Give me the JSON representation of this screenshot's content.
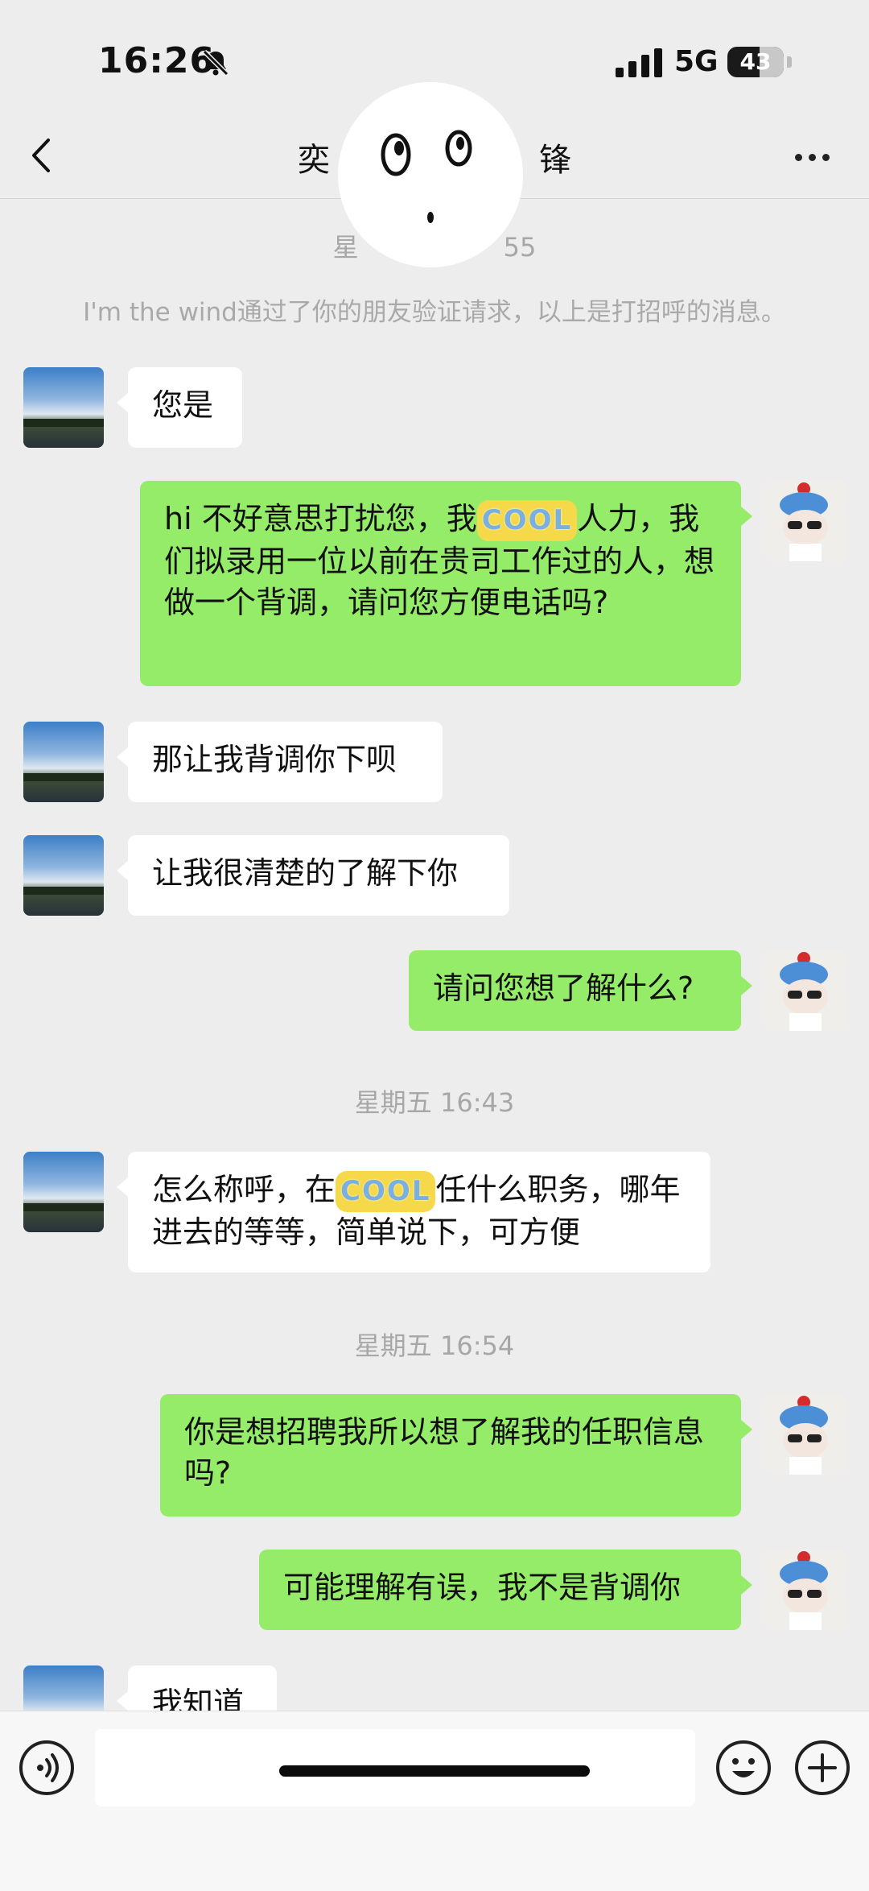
{
  "status_bar": {
    "time": "16:26",
    "network": "5G",
    "battery": "43"
  },
  "nav": {
    "title_left": "奕",
    "title_right": "锋"
  },
  "chat": {
    "header_timestamp": "星",
    "header_timestamp_tail": "55",
    "system_message": "I'm the wind通过了你的朋友验证请求，以上是打招呼的消息。",
    "messages": [
      {
        "side": "in",
        "text": "您是"
      },
      {
        "side": "out",
        "text_a": "hi 不好意思打扰您，我",
        "cool": "COOL",
        "text_b": "人力，我们拟录用一位以前在贵司工作过的人，想做一个背调，请问您方便电话吗?"
      },
      {
        "side": "in",
        "text": "那让我背调你下呗"
      },
      {
        "side": "in",
        "text": "让我很清楚的了解下你"
      },
      {
        "side": "out",
        "text": "请问您想了解什么?"
      },
      {
        "side": "in",
        "text_a": "怎么称呼，在",
        "cool": "COOL",
        "text_b": "任什么职务，哪年进去的等等，简单说下，可方便"
      },
      {
        "side": "out",
        "text": "你是想招聘我所以想了解我的任职信息吗?"
      },
      {
        "side": "out",
        "text": "可能理解有误，我不是背调你"
      },
      {
        "side": "in",
        "text": "我知道"
      }
    ],
    "timestamps": [
      "星期五 16:43",
      "星期五 16:54"
    ]
  },
  "input_bar": {
    "placeholder": ""
  },
  "icons": {
    "back": "chevron-left-icon",
    "more": "more-dots-icon",
    "voice": "voice-icon",
    "emoji": "emoji-icon",
    "plus": "plus-icon",
    "mute": "bell-slash-icon",
    "signal": "signal-icon"
  }
}
